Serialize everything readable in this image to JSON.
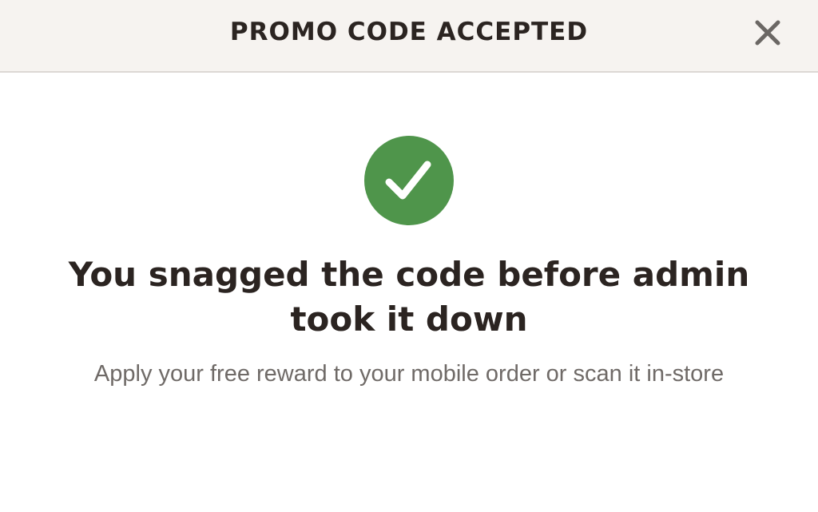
{
  "modal": {
    "title": "PROMO CODE ACCEPTED",
    "close_icon": "close-icon",
    "status_icon": "check-circle-icon",
    "headline": "You snagged the code before admin took it down",
    "message": "Apply your free reward to your mobile order or scan it in-store"
  },
  "colors": {
    "header_background": "#f6f3f0",
    "title_text": "#2b2421",
    "close_icon": "#6b6764",
    "success_green": "#4f954b",
    "body_text": "#6f6a67"
  }
}
